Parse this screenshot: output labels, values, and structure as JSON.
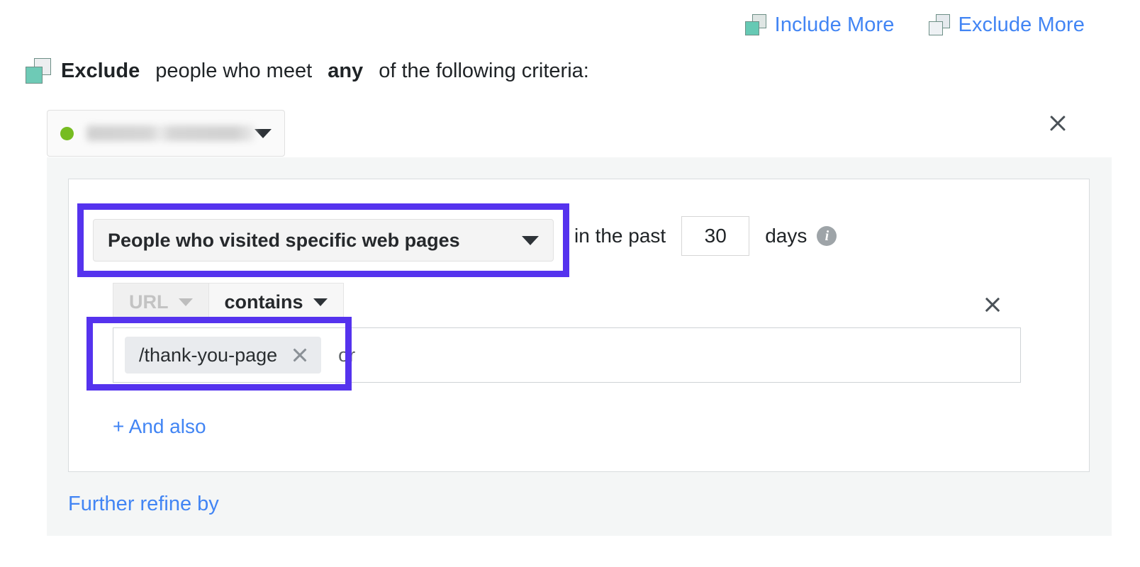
{
  "top_actions": [
    {
      "label": "Include More",
      "icon": "include-overlapping-squares-icon",
      "color": "#4285f4"
    },
    {
      "label": "Exclude More",
      "icon": "exclude-overlapping-squares-icon",
      "color": "#4285f4"
    }
  ],
  "criteria_header": {
    "icon": "exclude-overlapping-squares-icon",
    "strong_1": "Exclude",
    "text_1": " people who meet ",
    "strong_2": "any",
    "text_2": " of the following criteria:"
  },
  "audience_pill": {
    "status_dot_color": "#76bc21",
    "name": "",
    "name_redacted": true,
    "caret": "chevron-down-icon"
  },
  "panel": {
    "remove_label": "close-icon"
  },
  "rule": {
    "action_dropdown": {
      "label": "People who visited specific web pages",
      "caret": "chevron-down-icon",
      "highlighted": true,
      "highlight_color": "#5533ee"
    },
    "timeframe": {
      "prefix": "in the past",
      "value": "30",
      "placeholder": "30",
      "suffix": "days",
      "info_icon": "info-icon"
    },
    "condition_tabs": [
      {
        "label": "URL",
        "state": "disabled",
        "caret": "chevron-down-icon"
      },
      {
        "label": "contains",
        "state": "active",
        "caret": "chevron-down-icon"
      }
    ],
    "row_remove": "close-icon",
    "tag_field": {
      "tags": [
        {
          "label": "/thank-you-page",
          "remove": "close-icon"
        }
      ],
      "placeholder": "or",
      "highlighted": true,
      "highlight_color": "#5533ee"
    },
    "and_also_label": "+ And also"
  },
  "further_refine_label": "Further refine by"
}
